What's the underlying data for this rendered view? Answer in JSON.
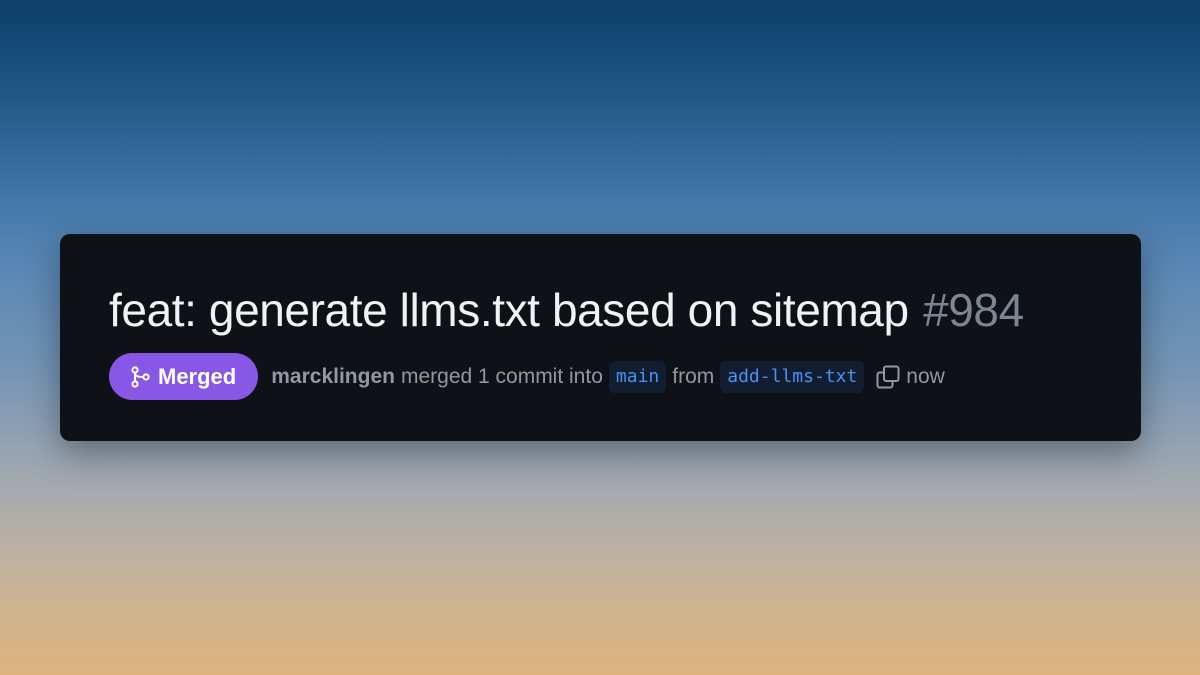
{
  "pull_request": {
    "title": "feat: generate llms.txt based on sitemap",
    "number": "#984",
    "status": {
      "label": "Merged",
      "icon": "git-merge-icon",
      "color": "#8957e5"
    },
    "author": "marcklingen",
    "action_text": "merged 1 commit into",
    "base_branch": "main",
    "from_text": "from",
    "head_branch": "add-llms-txt",
    "copy_icon": "copy-icon",
    "time": "now"
  },
  "colors": {
    "card_background": "#0e1116",
    "title": "#f0f3f6",
    "muted": "#9198a1",
    "branch_text": "#4493f8",
    "branch_background": "#121d2f"
  }
}
